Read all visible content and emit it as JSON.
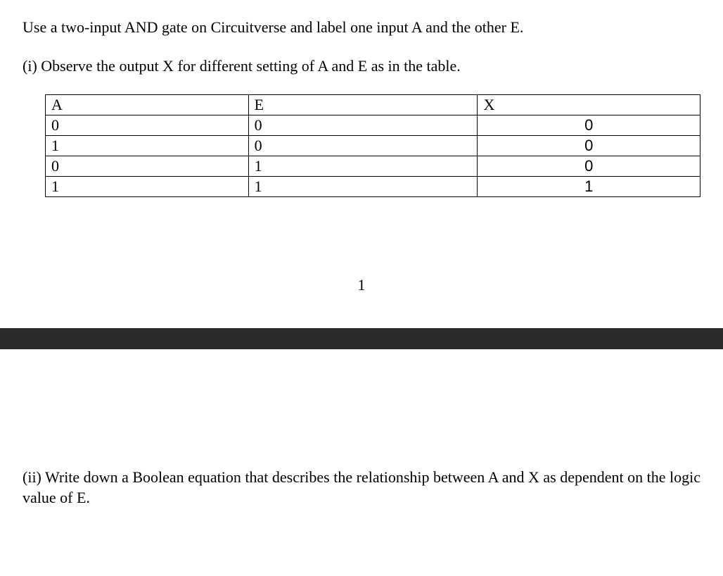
{
  "intro": "Use a two-input AND gate on Circuitverse and label one input A and the other E.",
  "part_i": "(i) Observe the output X for different setting of A and E as in the table.",
  "table": {
    "headers": {
      "a": "A",
      "e": "E",
      "x": "X"
    },
    "rows": [
      {
        "a": "0",
        "e": "0",
        "x": "0"
      },
      {
        "a": "1",
        "e": "0",
        "x": "0"
      },
      {
        "a": "0",
        "e": "1",
        "x": "0"
      },
      {
        "a": "1",
        "e": "1",
        "x": "1"
      }
    ]
  },
  "page_number": "1",
  "part_ii": "(ii) Write down a Boolean equation that describes the relationship between A and X as dependent on the logic value of E."
}
